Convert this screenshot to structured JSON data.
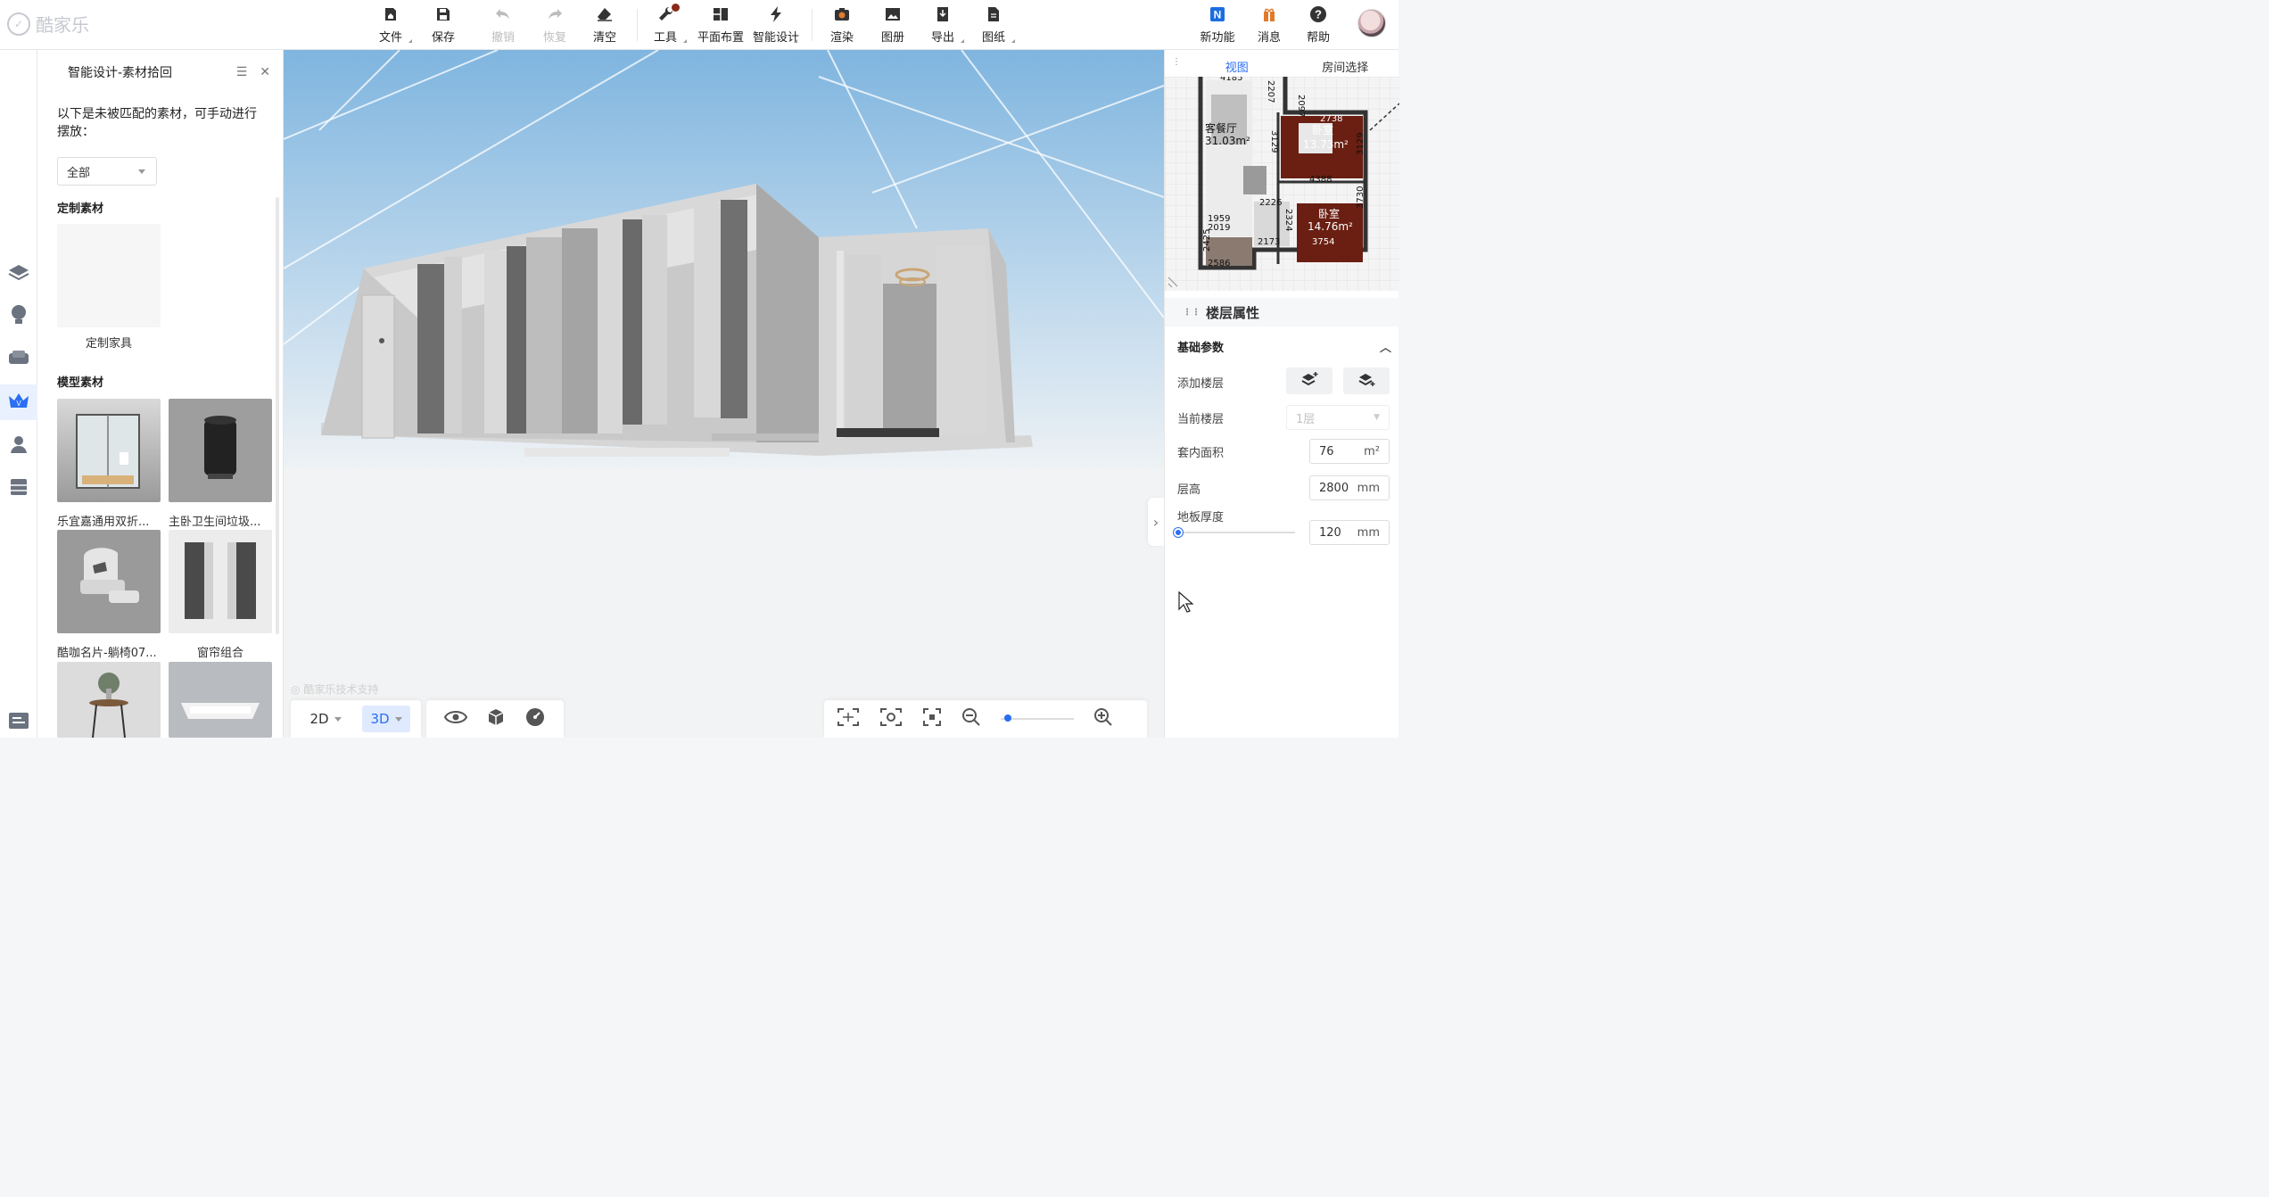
{
  "app": {
    "logo_text": "酷家乐"
  },
  "toolbar": {
    "file": "文件",
    "save": "保存",
    "undo": "撤销",
    "redo": "恢复",
    "clear": "清空",
    "tools": "工具",
    "floor_layout": "平面布置",
    "smart_design": "智能设计",
    "render": "渲染",
    "album": "图册",
    "export": "导出",
    "drawings": "图纸",
    "new_features": "新功能",
    "messages": "消息",
    "help": "帮助"
  },
  "left_panel": {
    "title": "智能设计-素材拾回",
    "description": "以下是未被匹配的素材，可手动进行摆放：",
    "filter_value": "全部",
    "custom_section": "定制素材",
    "custom_items": [
      {
        "label": "定制家具"
      }
    ],
    "model_section": "模型素材",
    "model_items": [
      {
        "label": "乐宜嘉通用双折..."
      },
      {
        "label": "主卧卫生间垃圾..."
      },
      {
        "label": "酷咖名片-躺椅07..."
      },
      {
        "label": "窗帘组合"
      }
    ]
  },
  "viewport": {
    "watermark": "酷家乐技术支持",
    "mode_2d": "2D",
    "mode_3d": "3D",
    "zoom_percent": 5
  },
  "right_panel": {
    "tabs": [
      "视图",
      "房间选择"
    ],
    "minimap": {
      "rooms": [
        {
          "name": "客餐厅",
          "area": "31.03m²"
        },
        {
          "name": "卧室",
          "area": "13.73m²"
        },
        {
          "name": "卧室",
          "area": "14.76m²"
        }
      ],
      "dims": [
        "4185",
        "2097",
        "2738",
        "4388",
        "2226",
        "1959",
        "2019",
        "2173",
        "3754",
        "2425",
        "2586",
        "3730",
        "3129",
        "3129",
        "2324",
        "2207"
      ]
    },
    "floor_props_title": "楼层属性",
    "basic_params": "基础参数",
    "add_floor_label": "添加楼层",
    "current_floor_label": "当前楼层",
    "current_floor_value": "1层",
    "inner_area_label": "套内面积",
    "inner_area_value": "76",
    "inner_area_unit": "m²",
    "floor_height_label": "层高",
    "floor_height_value": "2800",
    "floor_height_unit": "mm",
    "slab_thickness_label": "地板厚度",
    "slab_thickness_value": "120",
    "slab_thickness_unit": "mm"
  },
  "colors": {
    "accent": "#2a6ef3",
    "sky_top": "#7fb5df",
    "wall": "#cfcfcf"
  }
}
